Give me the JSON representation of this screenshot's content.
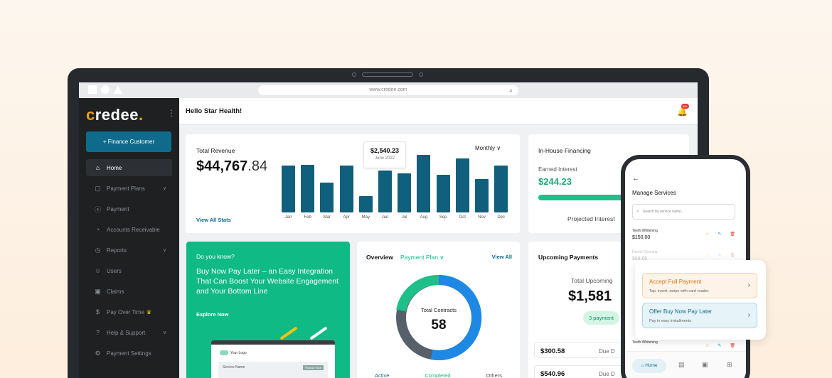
{
  "browser": {
    "url": "www.credee.com"
  },
  "sidebar": {
    "logo_first": "c",
    "logo_rest": "redee",
    "logo_dot": ".",
    "finance_button": "+ Finance Customer",
    "items": [
      {
        "label": "Home",
        "icon": "home-icon"
      },
      {
        "label": "Payment Plans",
        "icon": "document-icon"
      },
      {
        "label": "Payment",
        "icon": "dollar-circle-icon"
      },
      {
        "label": "Accounts Receivable",
        "icon": "hand-coin-icon"
      },
      {
        "label": "Reports",
        "icon": "clock-icon"
      },
      {
        "label": "Users",
        "icon": "users-icon"
      },
      {
        "label": "Claims",
        "icon": "briefcase-icon"
      },
      {
        "label": "Pay Over Time",
        "icon": "money-icon"
      },
      {
        "label": "Help & Support",
        "icon": "help-icon"
      },
      {
        "label": "Payment Settings",
        "icon": "gear-icon"
      }
    ]
  },
  "header": {
    "title": "Hello Star Health!",
    "badge": "99+"
  },
  "revenue": {
    "label": "Total Revenue",
    "value_main": "$44,767",
    "value_cents": ".84",
    "view_all": "View All Stats",
    "period": "Monthly",
    "tooltip_value": "$2,540.23",
    "tooltip_date": "June 2022"
  },
  "chart_data": {
    "type": "bar",
    "categories": [
      "Jan",
      "Feb",
      "Mar",
      "Apr",
      "May",
      "Jun",
      "Jul",
      "Aug",
      "Sep",
      "Oct",
      "Nov",
      "Dec"
    ],
    "values": [
      66,
      67,
      42,
      66,
      23,
      59,
      55,
      81,
      53,
      76,
      47,
      66
    ],
    "ylim": [
      0,
      100
    ]
  },
  "inhouse": {
    "title": "In-House Financing",
    "earned_label": "Earned Interest",
    "earned_value": "$244.23",
    "progress": 0.6,
    "projected": "Projected Interest"
  },
  "promo": {
    "question": "Do you know?",
    "headline": "Buy Now Pay Later – an Easy Integration That Can Boost Your Website Engagement and Your Bottom Line",
    "cta": "Explore Now",
    "mini_logo": "Your Logo",
    "mini_service": "Service Name",
    "mini_pay": "Finance Now"
  },
  "overview": {
    "title": "Overview",
    "plan": "Payment Plan",
    "view_all": "View All",
    "center_label": "Total Contracts",
    "center_value": "58",
    "tabs": [
      "Active",
      "Completed",
      "Others"
    ]
  },
  "upcoming": {
    "title": "Upcoming Payments",
    "total_label": "Total Upcoming",
    "total_value": "$1,581",
    "pill": "3 payment",
    "rows": [
      {
        "amount": "$300.58",
        "due": "Due D"
      },
      {
        "amount": "$540.96",
        "due": "Due D"
      }
    ]
  },
  "phone": {
    "title": "Manage Services",
    "search_placeholder": "Search by service name...",
    "items": [
      {
        "name": "Teeth Whitening",
        "price": "$150.00"
      },
      {
        "name": "Dental Cleaning",
        "price": "$99.00"
      },
      {
        "name": "Teeth Whitening",
        "price": ""
      }
    ],
    "nav_home": "Home"
  },
  "popup": {
    "opt1_title": "Accept Full Payment",
    "opt1_sub": "Tap, insert, swipe with card reader.",
    "opt2_title": "Offer Buy Now Pay Later",
    "opt2_sub": "Pay in easy installments"
  },
  "colors": {
    "brand": "#0f6b8c",
    "accent": "#0fba84",
    "logo": "#f39c12"
  }
}
